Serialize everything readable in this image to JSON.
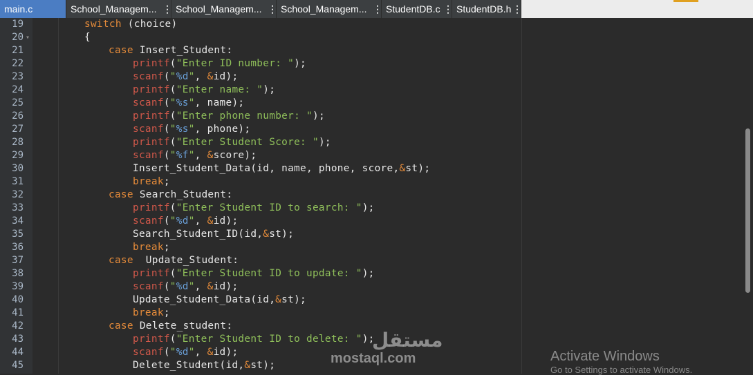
{
  "tabs": [
    {
      "label": "main.c",
      "active": true
    },
    {
      "label": "School_Managem..."
    },
    {
      "label": "School_Managem..."
    },
    {
      "label": "School_Managem..."
    },
    {
      "label": "StudentDB.c"
    },
    {
      "label": "StudentDB.h"
    }
  ],
  "tab_menu_glyph": "⋮",
  "line_numbers": [
    "19",
    "20",
    "21",
    "22",
    "23",
    "24",
    "25",
    "26",
    "27",
    "28",
    "29",
    "30",
    "31",
    "32",
    "33",
    "34",
    "35",
    "36",
    "37",
    "38",
    "39",
    "40",
    "41",
    "42",
    "43",
    "44",
    "45"
  ],
  "fold_marker": "▾",
  "code": {
    "l19": {
      "kw": "switch",
      "rest": " (choice)"
    },
    "l20": {
      "text": "{"
    },
    "l21": {
      "kw": "case",
      "rest": " Insert_Student:"
    },
    "l22": {
      "fn": "printf",
      "open": "(",
      "str": "\"Enter ID number: \"",
      "close": ");"
    },
    "l23": {
      "fn": "scanf",
      "open": "(",
      "q1": "\"",
      "fmt": "%d",
      "q2": "\"",
      "rest": ", ",
      "amp": "&",
      "rest2": "id);"
    },
    "l24": {
      "fn": "printf",
      "open": "(",
      "str": "\"Enter name: \"",
      "close": ");"
    },
    "l25": {
      "fn": "scanf",
      "open": "(",
      "q1": "\"",
      "fmt": "%s",
      "q2": "\"",
      "rest": ", name);"
    },
    "l26": {
      "fn": "printf",
      "open": "(",
      "str": "\"Enter phone number: \"",
      "close": ");"
    },
    "l27": {
      "fn": "scanf",
      "open": "(",
      "q1": "\"",
      "fmt": "%s",
      "q2": "\"",
      "rest": ", phone);"
    },
    "l28": {
      "fn": "printf",
      "open": "(",
      "str": "\"Enter Student Score: \"",
      "close": ");"
    },
    "l29": {
      "fn": "scanf",
      "open": "(",
      "q1": "\"",
      "fmt": "%f",
      "q2": "\"",
      "rest": ", ",
      "amp": "&",
      "rest2": "score);"
    },
    "l30": {
      "pre": "Insert_Student_Data(id, name, phone, score,",
      "amp": "&",
      "post": "st);"
    },
    "l31": {
      "kw": "break",
      "rest": ";"
    },
    "l32": {
      "kw": "case",
      "rest": " Search_Student:"
    },
    "l33": {
      "fn": "printf",
      "open": "(",
      "str": "\"Enter Student ID to search: \"",
      "close": ");"
    },
    "l34": {
      "fn": "scanf",
      "open": "(",
      "q1": "\"",
      "fmt": "%d",
      "q2": "\"",
      "rest": ", ",
      "amp": "&",
      "rest2": "id);"
    },
    "l35": {
      "pre": "Search_Student_ID(id,",
      "amp": "&",
      "post": "st);"
    },
    "l36": {
      "kw": "break",
      "rest": ";"
    },
    "l37": {
      "kw": "case",
      "rest": "  Update_Student:"
    },
    "l38": {
      "fn": "printf",
      "open": "(",
      "str": "\"Enter Student ID to update: \"",
      "close": ");"
    },
    "l39": {
      "fn": "scanf",
      "open": "(",
      "q1": "\"",
      "fmt": "%d",
      "q2": "\"",
      "rest": ", ",
      "amp": "&",
      "rest2": "id);"
    },
    "l40": {
      "pre": "Update_Student_Data(id,",
      "amp": "&",
      "post": "st);"
    },
    "l41": {
      "kw": "break",
      "rest": ";"
    },
    "l42": {
      "kw": "case",
      "rest": " Delete_student:"
    },
    "l43": {
      "fn": "printf",
      "open": "(",
      "str": "\"Enter Student ID to delete: \"",
      "close": ");"
    },
    "l44": {
      "fn": "scanf",
      "open": "(",
      "q1": "\"",
      "fmt": "%d",
      "q2": "\"",
      "rest": ", ",
      "amp": "&",
      "rest2": "id);"
    },
    "l45": {
      "pre": "Delete_Student(id,",
      "amp": "&",
      "post": "st);"
    }
  },
  "watermark": {
    "arabic": "مستقل",
    "latin": "mostaql.com"
  },
  "activate": {
    "title": "Activate Windows",
    "subtitle": "Go to Settings to activate Windows."
  },
  "colors": {
    "accent_tab": "#4b7dc3",
    "keyword": "#e58b3a",
    "function": "#d0584a",
    "string": "#8fbf5a",
    "format": "#6a9fd8"
  }
}
